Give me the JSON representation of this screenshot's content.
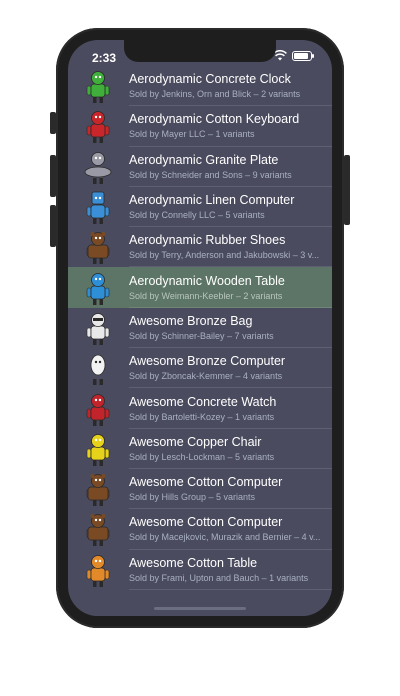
{
  "status_bar": {
    "time": "2:33",
    "wifi_icon": "wifi-icon",
    "battery_icon": "battery-icon"
  },
  "selected_index": 5,
  "products": [
    {
      "title": "Aerodynamic Concrete Clock",
      "subtitle": "Sold by Jenkins, Orn and Blick – 2 variants",
      "color": "#3fae3a",
      "figure": "robot"
    },
    {
      "title": "Aerodynamic Cotton Keyboard",
      "subtitle": "Sold by Mayer LLC – 1 variants",
      "color": "#c8262b",
      "figure": "robot-round"
    },
    {
      "title": "Aerodynamic Granite Plate",
      "subtitle": "Sold by Schneider and Sons – 9 variants",
      "color": "#9a9aa6",
      "figure": "robot-saucer"
    },
    {
      "title": "Aerodynamic Linen Computer",
      "subtitle": "Sold by Connelly LLC – 5 variants",
      "color": "#3b8fd6",
      "figure": "robot-box"
    },
    {
      "title": "Aerodynamic Rubber Shoes",
      "subtitle": "Sold by Terry, Anderson and Jakubowski – 3 v...",
      "color": "#7a4a24",
      "figure": "robot-bear"
    },
    {
      "title": "Aerodynamic Wooden Table",
      "subtitle": "Sold by Weimann-Keebler – 2 variants",
      "color": "#2f8fd6",
      "figure": "robot-blue"
    },
    {
      "title": "Awesome Bronze Bag",
      "subtitle": "Sold by Schinner-Bailey – 7 variants",
      "color": "#e9e9e9",
      "figure": "robot-white"
    },
    {
      "title": "Awesome Bronze Computer",
      "subtitle": "Sold by Zboncak-Kemmer – 4 variants",
      "color": "#f2f2f2",
      "figure": "robot-egg"
    },
    {
      "title": "Awesome Concrete Watch",
      "subtitle": "Sold by Bartoletti-Kozey – 1 variants",
      "color": "#c2242c",
      "figure": "robot-red"
    },
    {
      "title": "Awesome Copper Chair",
      "subtitle": "Sold by Lesch-Lockman – 5 variants",
      "color": "#e7d21b",
      "figure": "robot-yellow"
    },
    {
      "title": "Awesome Cotton Computer",
      "subtitle": "Sold by Hills Group – 5 variants",
      "color": "#7a4a24",
      "figure": "robot-bear"
    },
    {
      "title": "Awesome Cotton Computer",
      "subtitle": "Sold by Macejkovic, Murazik and Bernier – 4 v...",
      "color": "#7a4a24",
      "figure": "robot-bear"
    },
    {
      "title": "Awesome Cotton Table",
      "subtitle": "Sold by Frami, Upton and Bauch – 1 variants",
      "color": "#e28a2a",
      "figure": "robot-orange"
    }
  ]
}
